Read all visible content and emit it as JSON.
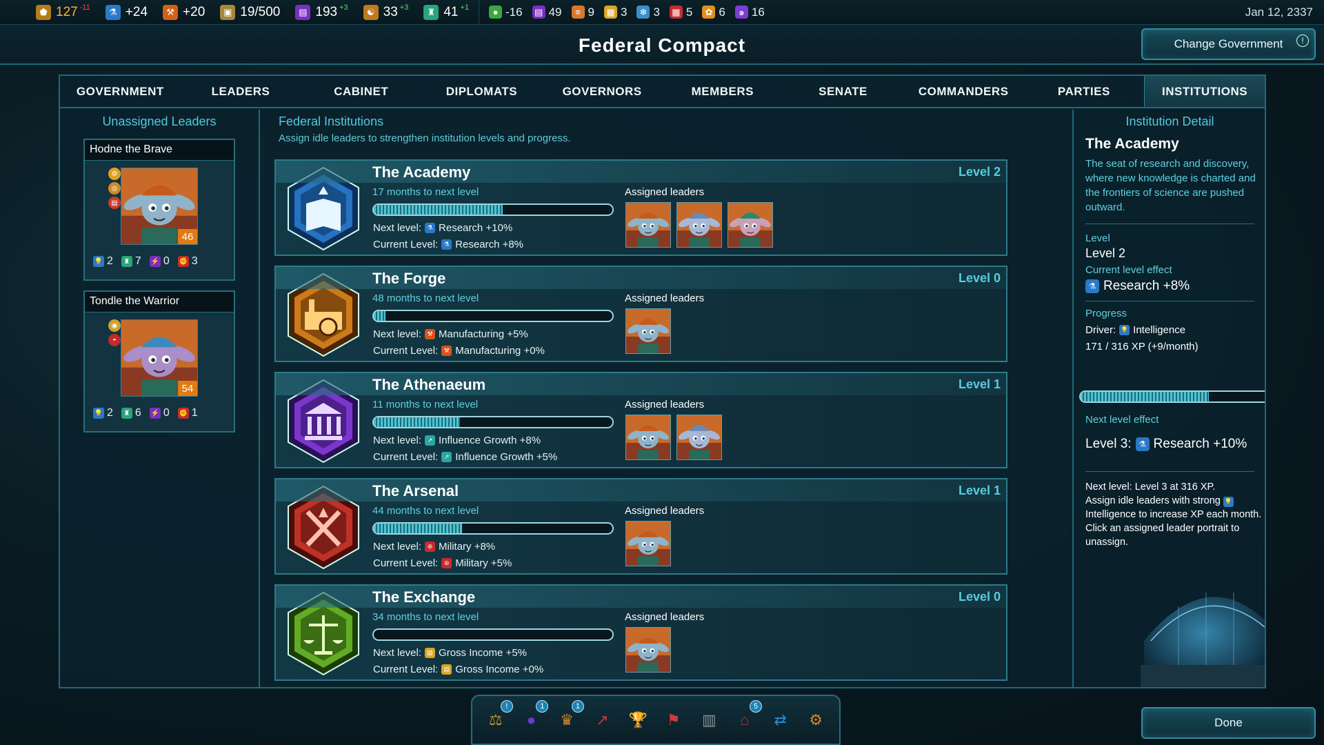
{
  "resources": [
    {
      "icon": "influence-icon",
      "value": "127",
      "delta": "-11",
      "color": "#ffb02e",
      "dcolor": "#ff4a4a",
      "bg": "#b27d1b"
    },
    {
      "icon": "research-icon",
      "value": "+24",
      "delta": "",
      "color": "#ffffff",
      "dcolor": "#ffffff",
      "bg": "#2a79c9"
    },
    {
      "icon": "manufacturing-icon",
      "value": "+20",
      "delta": "",
      "color": "#ffffff",
      "dcolor": "#ffffff",
      "bg": "#d16018"
    },
    {
      "icon": "crate-icon",
      "value": "19/500",
      "delta": "",
      "color": "#ffffff",
      "dcolor": "#ffffff",
      "bg": "#a8873b"
    },
    {
      "icon": "credits-icon",
      "value": "193",
      "delta": "+3",
      "color": "#ffffff",
      "dcolor": "#55e05a",
      "bg": "#7b2fc0"
    },
    {
      "icon": "approval-icon",
      "value": "33",
      "delta": "+3",
      "color": "#ffffff",
      "dcolor": "#55e05a",
      "bg": "#c07a1c"
    },
    {
      "icon": "population-icon",
      "value": "41",
      "delta": "+1",
      "color": "#ffffff",
      "dcolor": "#55e05a",
      "bg": "#2aa47a"
    }
  ],
  "resources2": [
    {
      "icon": "food-icon",
      "value": "-16",
      "bg": "#3aa83a"
    },
    {
      "icon": "document-icon",
      "value": "49",
      "bg": "#7b2fc0"
    },
    {
      "icon": "stack-icon",
      "value": "9",
      "bg": "#d8782a"
    },
    {
      "icon": "gold-icon",
      "value": "3",
      "bg": "#d9a623"
    },
    {
      "icon": "crystal-icon",
      "value": "3",
      "bg": "#3b8fc8"
    },
    {
      "icon": "red-grid-icon",
      "value": "5",
      "bg": "#c9292e"
    },
    {
      "icon": "flower-icon",
      "value": "6",
      "bg": "#e0901c"
    },
    {
      "icon": "swirl-icon",
      "value": "16",
      "bg": "#7b3fd0"
    }
  ],
  "date": "Jan 12, 2337",
  "title": "Federal Compact",
  "change_gov_label": "Change Government",
  "change_gov_alert": "!",
  "tabs": [
    "GOVERNMENT",
    "LEADERS",
    "CABINET",
    "DIPLOMATS",
    "GOVERNORS",
    "MEMBERS",
    "SENATE",
    "COMMANDERS",
    "PARTIES",
    "INSTITUTIONS"
  ],
  "active_tab": "INSTITUTIONS",
  "left": {
    "heading": "Unassigned Leaders",
    "leaders": [
      {
        "name": "Hodne the Brave",
        "level": "46",
        "stats": [
          "2",
          "7",
          "0",
          "3"
        ]
      },
      {
        "name": "Tondle the Warrior",
        "level": "54",
        "stats": [
          "2",
          "6",
          "0",
          "1"
        ]
      }
    ]
  },
  "center": {
    "heading": "Federal Institutions",
    "subtitle": "Assign idle leaders to strengthen institution levels and progress.",
    "assigned_label": "Assigned leaders",
    "next_label": "Next level:",
    "current_label": "Current Level:",
    "institutions": [
      {
        "name": "The Academy",
        "level": "Level 2",
        "months": "17 months to next level",
        "progress": 0.54,
        "next": "Research +10%",
        "current": "Research +8%",
        "bonus_icon": "research-icon",
        "bonus_color": "#2a79c9",
        "badge_color": "#2a7fd4",
        "badge_dark": "#0d2f5a",
        "assigned": 3
      },
      {
        "name": "The Forge",
        "level": "Level 0",
        "months": "48 months to next level",
        "progress": 0.05,
        "next": "Manufacturing +5%",
        "current": "Manufacturing +0%",
        "bonus_icon": "manufacturing-icon",
        "bonus_color": "#d8521c",
        "badge_color": "#e38a1e",
        "badge_dark": "#4a2406",
        "assigned": 1
      },
      {
        "name": "The Athenaeum",
        "level": "Level 1",
        "months": "11 months to next level",
        "progress": 0.36,
        "next": "Influence Growth +8%",
        "current": "Influence Growth +5%",
        "bonus_icon": "influence-growth-icon",
        "bonus_color": "#2aa8a0",
        "badge_color": "#8a3ee0",
        "badge_dark": "#2a0f55",
        "assigned": 2
      },
      {
        "name": "The Arsenal",
        "level": "Level 1",
        "months": "44 months to next level",
        "progress": 0.37,
        "next": "Military +8%",
        "current": "Military +5%",
        "bonus_icon": "military-icon",
        "bonus_color": "#c9292e",
        "badge_color": "#d23a2a",
        "badge_dark": "#4a0c0c",
        "assigned": 1
      },
      {
        "name": "The Exchange",
        "level": "Level 0",
        "months": "34 months to next level",
        "progress": 0.0,
        "next": "Gross Income +5%",
        "current": "Gross Income +0%",
        "bonus_icon": "income-icon",
        "bonus_color": "#d9a623",
        "badge_color": "#6fbf2a",
        "badge_dark": "#1e3c08",
        "assigned": 1
      }
    ]
  },
  "detail": {
    "heading": "Institution Detail",
    "name": "The Academy",
    "description": "The seat of research and discovery, where new knowledge is charted and the frontiers of science are pushed outward.",
    "level_label": "Level",
    "level_value": "Level 2",
    "current_label": "Current level effect",
    "current_value": "Research +8%",
    "progress_label": "Progress",
    "driver_label": "Driver:",
    "driver_value": "Intelligence",
    "xp": "171 / 316 XP (+9/month)",
    "progress": 0.54,
    "next_label": "Next level effect",
    "next_prefix": "Level 3:",
    "next_value": "Research +10%",
    "note1": "Next level: Level 3 at 316 XP.",
    "note2": "Assign idle leaders with strong",
    "note3": "Intelligence to increase XP each month.",
    "note4": "Click an assigned leader portrait to unassign."
  },
  "bottom_icons": [
    {
      "name": "justice-icon",
      "badge": "!",
      "color": "#c98b2a"
    },
    {
      "name": "planet-icon",
      "badge": "1",
      "color": "#6a3ad0"
    },
    {
      "name": "crown-icon",
      "badge": "1",
      "color": "#d08a2a"
    },
    {
      "name": "graph-icon",
      "badge": "",
      "color": "#c73a3a"
    },
    {
      "name": "trophy-icon",
      "badge": "",
      "color": "#9aa3a8"
    },
    {
      "name": "flag-icon",
      "badge": "",
      "color": "#d03a3a"
    },
    {
      "name": "pillar-icon",
      "badge": "",
      "color": "#8a959a"
    },
    {
      "name": "house-icon",
      "badge": "5",
      "color": "#c0272e"
    },
    {
      "name": "handshake-icon",
      "badge": "",
      "color": "#2a8ad0"
    },
    {
      "name": "settings-icon",
      "badge": "",
      "color": "#d0862a"
    }
  ],
  "done_label": "Done"
}
